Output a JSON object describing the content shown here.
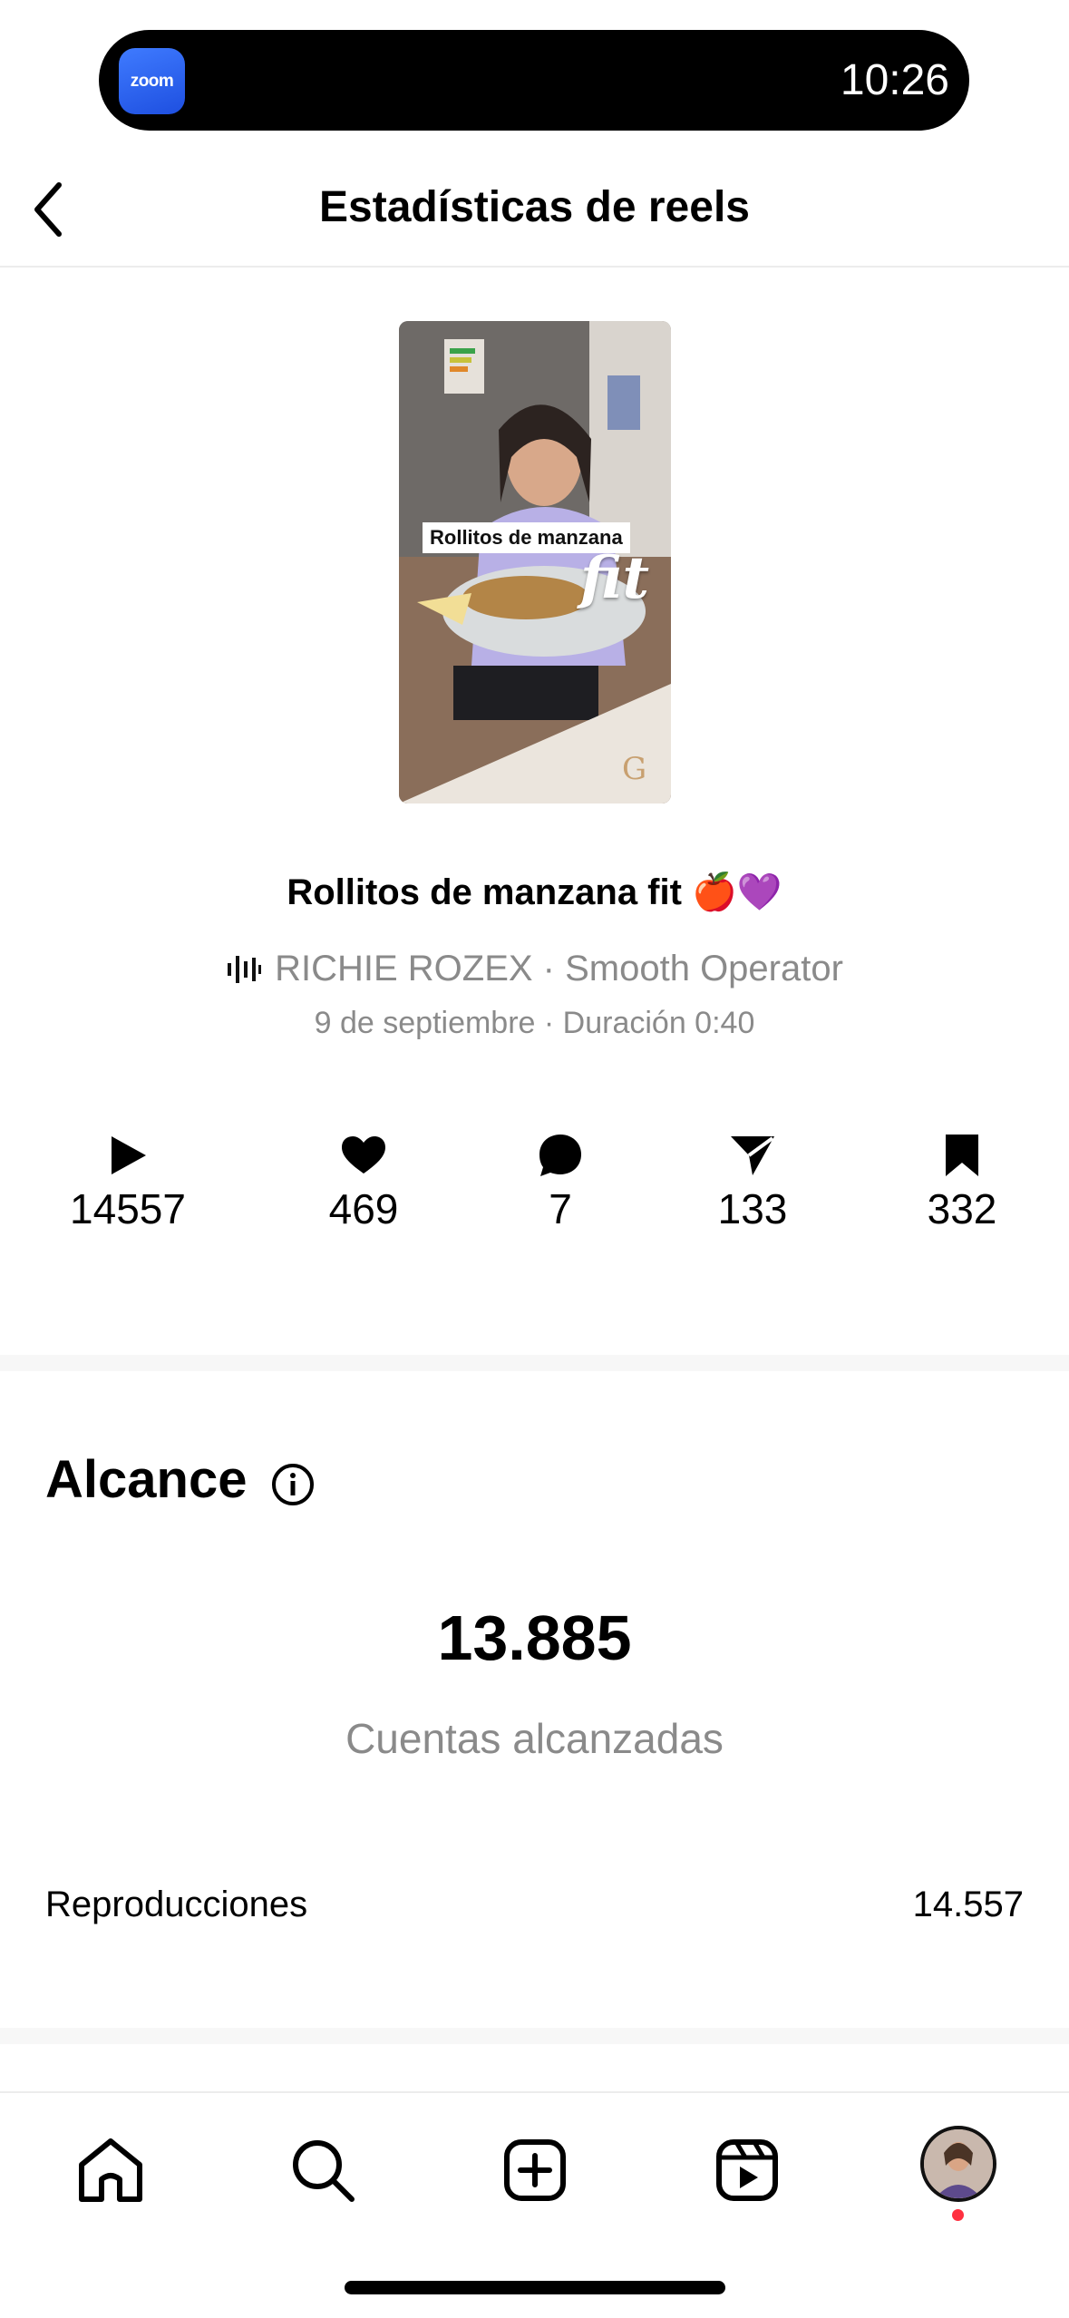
{
  "status": {
    "app_badge": "zoom",
    "time": "10:26"
  },
  "header": {
    "title": "Estadísticas de reels",
    "back_icon": "chevron-left-icon"
  },
  "reel": {
    "thumbnail_caption": "Rollitos de manzana",
    "thumbnail_overlay": "fit",
    "title": "Rollitos de manzana fit 🍎💜",
    "audio": "RICHIE ROZEX · Smooth Operator",
    "date_duration": "9 de septiembre · Duración 0:40"
  },
  "metrics": [
    {
      "icon": "play-icon",
      "value": "14557"
    },
    {
      "icon": "heart-icon",
      "value": "469"
    },
    {
      "icon": "comment-icon",
      "value": "7"
    },
    {
      "icon": "send-icon",
      "value": "133"
    },
    {
      "icon": "bookmark-icon",
      "value": "332"
    }
  ],
  "reach": {
    "title": "Alcance",
    "value": "13.885",
    "label": "Cuentas alcanzadas",
    "rows": [
      {
        "label": "Reproducciones",
        "value": "14.557"
      }
    ]
  },
  "nav": {
    "items": [
      "home-icon",
      "search-icon",
      "create-icon",
      "reels-icon",
      "profile-avatar"
    ]
  },
  "colors": {
    "secondary_text": "#8a8a8a",
    "notification": "#ff3040",
    "zoom_blue": "#2d6bff"
  }
}
